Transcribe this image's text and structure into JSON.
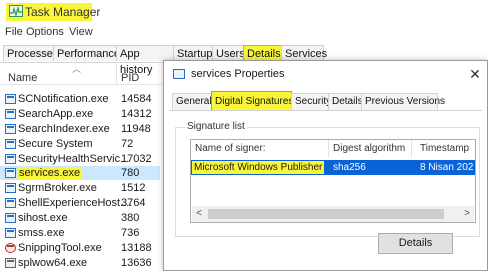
{
  "app": {
    "title": "Task Manager",
    "title_highlight": "#fbf53a"
  },
  "menu": [
    "File",
    "Options",
    "View"
  ],
  "tabs": [
    {
      "label": "Processes"
    },
    {
      "label": "Performance"
    },
    {
      "label": "App history"
    },
    {
      "label": "Startup"
    },
    {
      "label": "Users"
    },
    {
      "label": "Details",
      "active": true
    },
    {
      "label": "Services"
    }
  ],
  "columns": {
    "name": "Name",
    "pid": "PID"
  },
  "processes": [
    {
      "name": "SCNotification.exe",
      "pid": "14584",
      "icon": "app-icon"
    },
    {
      "name": "SearchApp.exe",
      "pid": "14312",
      "icon": "app-icon"
    },
    {
      "name": "SearchIndexer.exe",
      "pid": "11948",
      "icon": "app-icon"
    },
    {
      "name": "Secure System",
      "pid": "72",
      "icon": "app-icon"
    },
    {
      "name": "SecurityHealthServic...",
      "pid": "17032",
      "icon": "app-icon"
    },
    {
      "name": "services.exe",
      "pid": "780",
      "icon": "app-icon",
      "selected": true
    },
    {
      "name": "SgrmBroker.exe",
      "pid": "1512",
      "icon": "app-icon"
    },
    {
      "name": "ShellExperienceHost....",
      "pid": "3764",
      "icon": "app-icon"
    },
    {
      "name": "sihost.exe",
      "pid": "380",
      "icon": "app-icon"
    },
    {
      "name": "smss.exe",
      "pid": "736",
      "icon": "app-icon"
    },
    {
      "name": "SnippingTool.exe",
      "pid": "13188",
      "icon": "snipping-tool-icon"
    },
    {
      "name": "splwow64.exe",
      "pid": "13636",
      "icon": "printer-icon"
    }
  ],
  "dialog": {
    "title": "services Properties",
    "tabs": [
      {
        "label": "General"
      },
      {
        "label": "Digital Signatures",
        "active": true
      },
      {
        "label": "Security"
      },
      {
        "label": "Details"
      },
      {
        "label": "Previous Versions"
      }
    ],
    "signature_list_label": "Signature list",
    "table_headers": {
      "signer": "Name of signer:",
      "digest": "Digest algorithm",
      "timestamp": "Timestamp"
    },
    "signature": {
      "signer": "Microsoft Windows Publisher",
      "digest": "sha256",
      "timestamp": "8 Nisan 202"
    },
    "details_button": "Details",
    "selection_color": "#0a64d8"
  }
}
